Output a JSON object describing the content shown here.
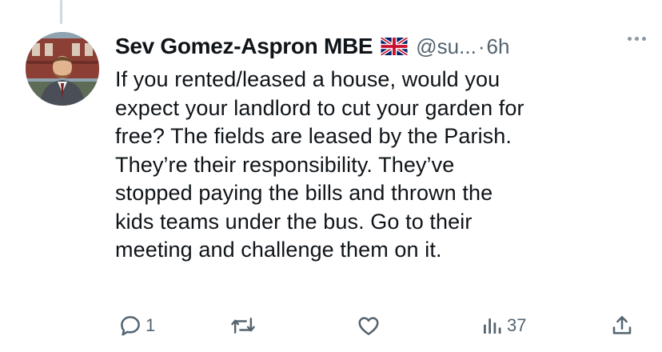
{
  "tweet": {
    "author_name": "Sev Gomez-Aspron MBE",
    "handle": "@su...",
    "separator": "·",
    "timestamp": "6h",
    "flag_icon": "union-jack-flag-icon",
    "text": "If you rented/leased a house, would you\nexpect your landlord to cut your garden for\nfree? The fields are leased by the Parish.\nThey’re their responsibility. They’ve\nstopped paying the bills and thrown the\nkids teams under the bus. Go to their\nmeeting and challenge them on it."
  },
  "actions": {
    "reply": {
      "icon": "reply-icon",
      "count": "1"
    },
    "retweet": {
      "icon": "retweet-icon",
      "count": ""
    },
    "like": {
      "icon": "heart-icon",
      "count": ""
    },
    "views": {
      "icon": "views-chart-icon",
      "count": "37"
    },
    "share": {
      "icon": "share-icon"
    }
  },
  "colors": {
    "text": "#0f1419",
    "secondary": "#536471",
    "thread_line": "#cfd9de"
  }
}
